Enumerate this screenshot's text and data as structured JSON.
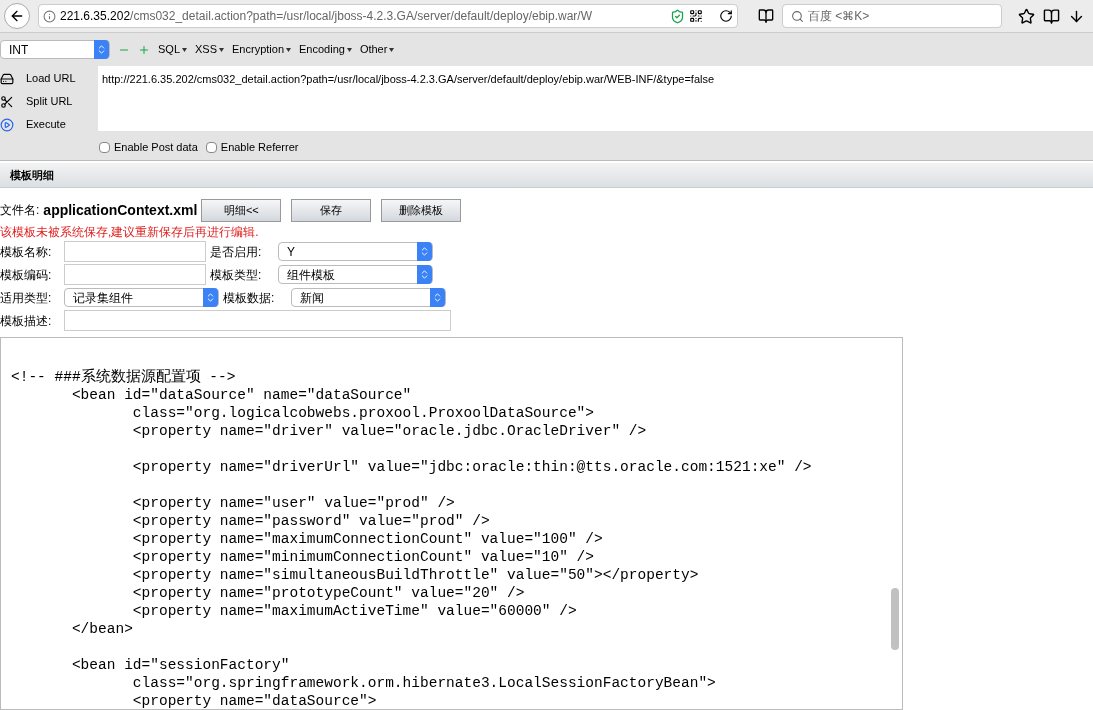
{
  "browser": {
    "url_host": "221.6.35.202",
    "url_path": "/cms032_detail.action?path=/usr/local/jboss-4.2.3.GA/server/default/deploy/ebip.war/W",
    "search_placeholder": "百度 <⌘K>"
  },
  "hackbar": {
    "type_select": "INT",
    "menus": [
      "SQL",
      "XSS",
      "Encryption",
      "Encoding",
      "Other"
    ],
    "actions": [
      {
        "kind": "load",
        "label": "Load URL"
      },
      {
        "kind": "split",
        "label": "Split URL"
      },
      {
        "kind": "execute",
        "label": "Execute"
      }
    ],
    "url_value": "http://221.6.35.202/cms032_detail.action?path=/usr/local/jboss-4.2.3.GA/server/default/deploy/ebip.war/WEB-INF/&type=false",
    "options": [
      {
        "label": "Enable Post data",
        "checked": false
      },
      {
        "label": "Enable Referrer",
        "checked": false
      }
    ]
  },
  "section_title": "模板明细",
  "file": {
    "label": "文件名:",
    "name": "applicationContext.xml",
    "buttons": [
      "明细<<",
      "保存",
      "删除模板"
    ]
  },
  "warning": "该模板未被系统保存,建议重新保存后再进行编辑.",
  "form_rows": [
    {
      "label": "模板名称:",
      "field": {
        "kind": "text"
      },
      "label2": "是否启用:",
      "field2": {
        "kind": "select",
        "value": "Y"
      }
    },
    {
      "label": "模板编码:",
      "field": {
        "kind": "text"
      },
      "label2": "模板类型:",
      "field2": {
        "kind": "select",
        "value": "组件模板"
      }
    },
    {
      "label": "适用类型:",
      "field": {
        "kind": "select",
        "value": "记录集组件"
      },
      "label2": "模板数据:",
      "field2": {
        "kind": "select",
        "value": "新闻"
      }
    },
    {
      "label": "模板描述:",
      "field": {
        "kind": "wide"
      }
    }
  ],
  "code": "\n<!-- ###系统数据源配置项 -->\n\t<bean id=\"dataSource\" name=\"dataSource\"\n\t\tclass=\"org.logicalcobwebs.proxool.ProxoolDataSource\">\n\t\t<property name=\"driver\" value=\"oracle.jdbc.OracleDriver\" />\n\n\t\t<property name=\"driverUrl\" value=\"jdbc:oracle:thin:@tts.oracle.com:1521:xe\" />\n\n\t\t<property name=\"user\" value=\"prod\" />\n\t\t<property name=\"password\" value=\"prod\" />\n\t\t<property name=\"maximumConnectionCount\" value=\"100\" />\n\t\t<property name=\"minimumConnectionCount\" value=\"10\" />\n\t\t<property name=\"simultaneousBuildThrottle\" value=\"50\"></property>\n\t\t<property name=\"prototypeCount\" value=\"20\" />\n\t\t<property name=\"maximumActiveTime\" value=\"60000\" />\n\t</bean>\n\n\t<bean id=\"sessionFactory\"\n\t\tclass=\"org.springframework.orm.hibernate3.LocalSessionFactoryBean\">\n\t\t<property name=\"dataSource\">"
}
